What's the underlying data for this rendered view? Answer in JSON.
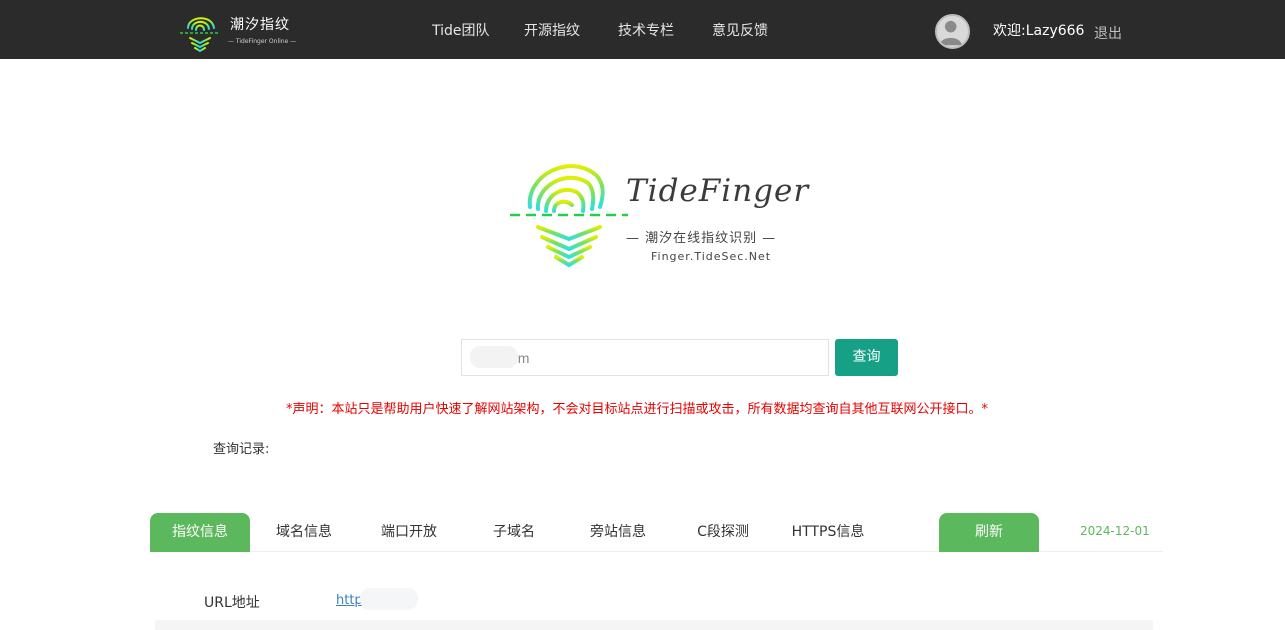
{
  "header": {
    "brand_title": "潮汐指纹",
    "brand_sub": "— TideFinger Online —",
    "nav": [
      "Tide团队",
      "开源指纹",
      "技术专栏",
      "意见反馈"
    ],
    "welcome": "欢迎:Lazy666",
    "logout": "退出"
  },
  "hero": {
    "title": "TideFinger",
    "tagline": "— 潮汐在线指纹识别 —",
    "domain": "Finger.TideSec.Net"
  },
  "search": {
    "value": "om",
    "button": "查询"
  },
  "disclaimer": "*声明：本站只是帮助用户快速了解网站架构，不会对目标站点进行扫描或攻击，所有数据均查询自其他互联网公开接口。*",
  "history_label": "查询记录:",
  "tabs": {
    "items": [
      "指纹信息",
      "域名信息",
      "端口开放",
      "子域名",
      "旁站信息",
      "C段探测",
      "HTTPS信息"
    ],
    "refresh": "刷新",
    "date": "2024-12-01"
  },
  "result": {
    "url_label": "URL地址",
    "url_value": "http          om"
  },
  "colors": {
    "topbar": "#2b2b2b",
    "accent_teal": "#16a085",
    "accent_green": "#5cb85c",
    "warning_red": "#e60000",
    "link_blue": "#3a7fc4"
  }
}
